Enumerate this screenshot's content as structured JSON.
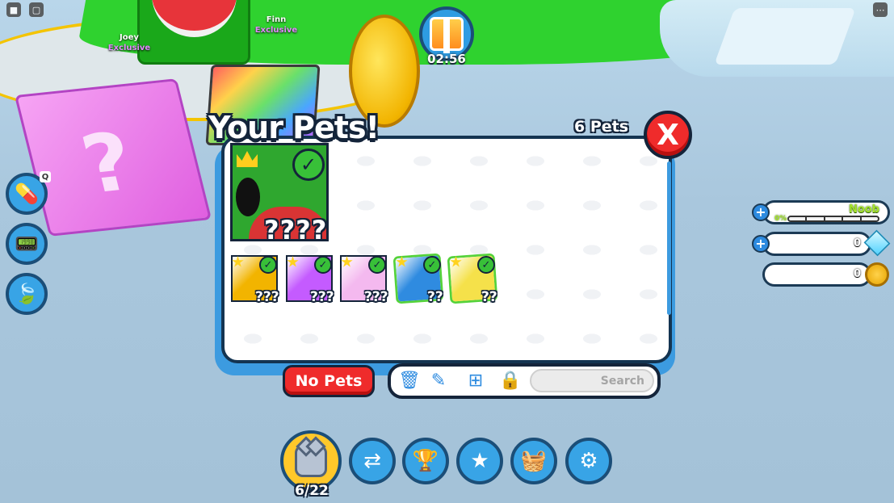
{
  "world": {
    "players": [
      {
        "name": "Joey",
        "tag": "Exclusive"
      },
      {
        "name": "Finn",
        "tag": "Exclusive"
      }
    ],
    "gift_timer": "02:56",
    "cube_glyph": "?"
  },
  "top_corner": {
    "left_icons": [
      "roblox-menu-icon",
      "chat-icon"
    ],
    "right_icons": [
      "settings-icon"
    ]
  },
  "left_menu": {
    "items": [
      {
        "name": "potion-icon",
        "hotkey": "Q"
      },
      {
        "name": "remote-icon",
        "hotkey": ""
      },
      {
        "name": "teleport-icon",
        "hotkey": ""
      }
    ]
  },
  "stats": {
    "rank_label": "Noob",
    "rank_progress": "0%",
    "rank_progress_fraction": 0,
    "diamonds": "0",
    "coins": "0"
  },
  "pets_panel": {
    "title": "Your Pets!",
    "count_label": "6 Pets",
    "close_label": "X",
    "featured": {
      "unknown_label": "????",
      "equipped": true,
      "crowned": true
    },
    "pets": [
      {
        "unknown_label": "???",
        "equipped": true,
        "color": "#f2b400"
      },
      {
        "unknown_label": "???",
        "equipped": true,
        "color": "#c45bff"
      },
      {
        "unknown_label": "???",
        "equipped": true,
        "color": "#f4b9ef"
      },
      {
        "unknown_label": "??",
        "equipped": true,
        "color": "#2f8be0"
      },
      {
        "unknown_label": "??",
        "equipped": true,
        "color": "#f5e14a"
      }
    ],
    "no_pets_button": "No Pets",
    "tools": [
      "trash-icon",
      "pencil-icon",
      "grid-icon",
      "lock-icon"
    ],
    "search_placeholder": "Search"
  },
  "hotbar": {
    "pets_slots": "6/22",
    "items": [
      "trade-icon",
      "trophy-icon",
      "star-icon",
      "shop-basket-icon",
      "settings-gear-icon"
    ]
  },
  "colors": {
    "accent_blue": "#38a4e6",
    "outline": "#14243a",
    "close_red": "#ef2b2b",
    "equipped_green": "#38c038"
  }
}
